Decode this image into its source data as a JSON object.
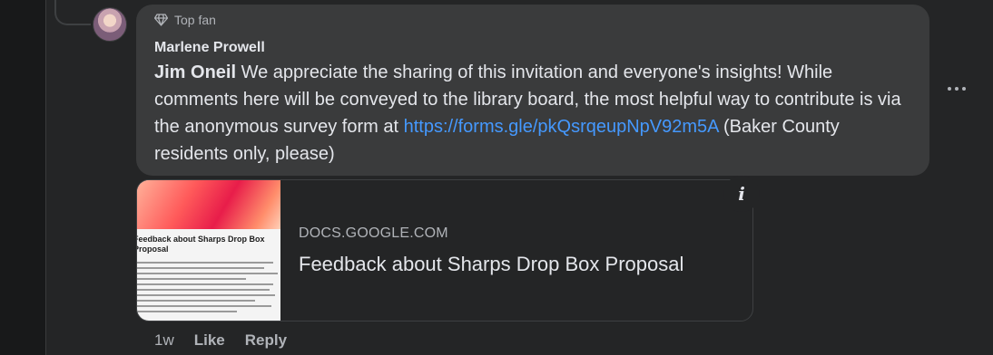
{
  "comment": {
    "badge_label": "Top fan",
    "author": "Marlene Prowell",
    "mention": "Jim Oneil",
    "text_before_link": " We appreciate the sharing of this invitation and everyone's insights! While comments here will be conveyed to the library board, the most helpful way to contribute is via the anonymous survey form at ",
    "link": "https://forms.gle/pkQsrqeupNpV92m5A",
    "text_after_link": " (Baker County residents only, please)"
  },
  "preview": {
    "domain": "DOCS.GOOGLE.COM",
    "title": "Feedback about Sharps Drop Box Proposal",
    "thumb_title": "Feedback about Sharps Drop Box Proposal",
    "info_label": "i"
  },
  "actions": {
    "time": "1w",
    "like": "Like",
    "reply": "Reply"
  },
  "colors": {
    "link": "#4599ff",
    "bubble": "#3a3b3c",
    "background": "#242526"
  },
  "icons": {
    "badge": "diamond-icon",
    "more": "more-options-icon",
    "info": "info-icon"
  }
}
